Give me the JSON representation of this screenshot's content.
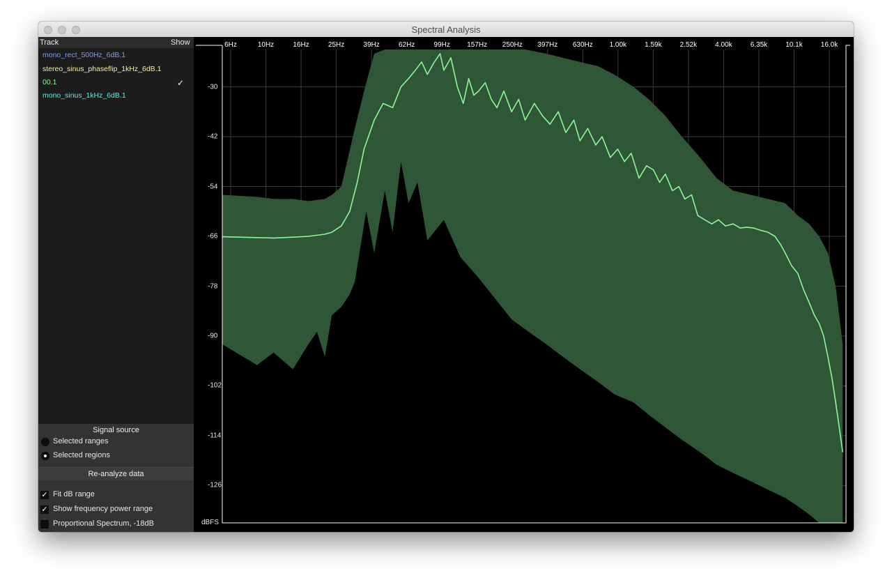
{
  "window": {
    "title": "Spectral Analysis"
  },
  "tracks": {
    "header_track": "Track",
    "header_show": "Show",
    "items": [
      {
        "name": "mono_rect_500Hz_6dB.1",
        "color": "#7f9bff",
        "shown": false
      },
      {
        "name": "stereo_sinus_phaseflip_1kHz_6dB.1",
        "color": "#f5efa0",
        "shown": false
      },
      {
        "name": "00.1",
        "color": "#8ef59a",
        "shown": true,
        "check": "✓"
      },
      {
        "name": "mono_sinus_1kHz_6dB.1",
        "color": "#5fe8e8",
        "shown": false
      }
    ]
  },
  "signal_source": {
    "title": "Signal source",
    "options": [
      {
        "label": "Selected ranges",
        "selected": false
      },
      {
        "label": "Selected regions",
        "selected": true
      }
    ]
  },
  "reanalyze_label": "Re-analyze data",
  "options": [
    {
      "label": "Fit dB range",
      "checked": true
    },
    {
      "label": "Show frequency power range",
      "checked": true
    },
    {
      "label": "Proportional Spectrum, -18dB",
      "checked": false
    }
  ],
  "check_glyph": "✓",
  "chart_data": {
    "type": "area",
    "x_scale": "log",
    "x_ticks": [
      "6Hz",
      "10Hz",
      "16Hz",
      "25Hz",
      "39Hz",
      "62Hz",
      "99Hz",
      "157Hz",
      "250Hz",
      "397Hz",
      "630Hz",
      "1.00k",
      "1.59k",
      "2.52k",
      "4.00k",
      "6.35k",
      "10.1k",
      "16.0k"
    ],
    "y_ticks": [
      "-30",
      "-42",
      "-54",
      "-66",
      "-78",
      "-90",
      "-102",
      "-114",
      "-126"
    ],
    "ylabel": "dBFS",
    "ylim": [
      -135,
      -21
    ],
    "xlim_hz": [
      5,
      23000
    ],
    "grid": true,
    "colors": {
      "band": "#2f5636",
      "line": "#8ff59b",
      "grid": "#3c3c3c",
      "accent": "#8ef59a"
    },
    "series": [
      {
        "name": "00.1",
        "role": "mean spectrum",
        "x": [
          5,
          8,
          10,
          13,
          16,
          20,
          22,
          25,
          28,
          31,
          34,
          39,
          44,
          50,
          56,
          62,
          68,
          74,
          80,
          88,
          95,
          100,
          110,
          120,
          130,
          140,
          150,
          160,
          175,
          190,
          205,
          225,
          250,
          275,
          300,
          340,
          380,
          420,
          470,
          520,
          580,
          630,
          700,
          780,
          850,
          950,
          1050,
          1150,
          1260,
          1400,
          1550,
          1700,
          1850,
          2000,
          2200,
          2400,
          2600,
          2850,
          3100,
          3400,
          3750,
          4100,
          4500,
          5000,
          5500,
          6000,
          6600,
          7200,
          8000,
          8800,
          9500,
          10100,
          11000,
          12000,
          13000,
          14000,
          15000,
          16000,
          17000,
          18000,
          19000,
          20000,
          21000,
          22000
        ],
        "y": [
          -66.1,
          -66.3,
          -66.4,
          -66.2,
          -66,
          -65.5,
          -65,
          -63.5,
          -60,
          -53,
          -45,
          -38,
          -34,
          -35,
          -30,
          -28,
          -26,
          -24,
          -27,
          -24,
          -22,
          -26,
          -23,
          -30,
          -34,
          -28,
          -32,
          -31,
          -29,
          -33,
          -35,
          -31,
          -36,
          -33,
          -38,
          -34,
          -37,
          -39,
          -36,
          -41,
          -38,
          -43,
          -40,
          -44,
          -42,
          -47,
          -45,
          -48,
          -46,
          -52,
          -49,
          -50,
          -53,
          -51,
          -55,
          -54,
          -57,
          -56,
          -61,
          -62,
          -63,
          -62,
          -63.5,
          -63,
          -64,
          -63.8,
          -64,
          -64.5,
          -65,
          -66,
          -68,
          -70,
          -73,
          -75,
          -79,
          -82,
          -85,
          -87,
          -90,
          -95,
          -100,
          -106,
          -112,
          -118
        ]
      },
      {
        "name": "power range max",
        "x": [
          5,
          8,
          10,
          13,
          16,
          20,
          22,
          25,
          30,
          35,
          39,
          45,
          50,
          56,
          62,
          70,
          80,
          100,
          125,
          150,
          200,
          250,
          300,
          400,
          500,
          630,
          800,
          1000,
          1300,
          1600,
          2000,
          2500,
          3200,
          4000,
          5000,
          6350,
          8000,
          10100,
          12000,
          14000,
          16000,
          18000,
          20000,
          22000
        ],
        "y": [
          -56,
          -56.5,
          -57,
          -57,
          -57.5,
          -57,
          -56,
          -54,
          -40,
          -29,
          -22,
          -21,
          -21,
          -21,
          -21,
          -21,
          -21,
          -21,
          -21,
          -21,
          -21,
          -21,
          -21,
          -22,
          -23,
          -24,
          -25,
          -27,
          -30,
          -33,
          -37,
          -42,
          -47,
          -52,
          -55,
          -56,
          -57,
          -58,
          -61,
          -63,
          -66,
          -70,
          -78,
          -92
        ]
      },
      {
        "name": "power range min",
        "x": [
          5,
          8,
          10,
          13,
          16,
          18,
          20,
          22,
          25,
          28,
          30,
          35,
          39,
          45,
          50,
          56,
          62,
          70,
          80,
          100,
          125,
          160,
          200,
          250,
          315,
          400,
          500,
          630,
          800,
          1000,
          1300,
          1600,
          2000,
          2500,
          3200,
          4000,
          5000,
          6350,
          8000,
          10100,
          12000,
          14000,
          16000,
          17000,
          18000,
          19000,
          20000,
          22000
        ],
        "y": [
          -92,
          -97,
          -94,
          -98,
          -92,
          -89,
          -95,
          -85,
          -83,
          -80,
          -77,
          -60,
          -70,
          -55,
          -65,
          -48,
          -58,
          -53,
          -67,
          -62,
          -71,
          -76,
          -81,
          -86,
          -89,
          -92,
          -95,
          -98,
          -101,
          -104,
          -106,
          -109,
          -112,
          -115,
          -118,
          -121,
          -123,
          -125,
          -127,
          -129,
          -131,
          -133,
          -136,
          -138,
          -140,
          -140,
          -140,
          -140
        ]
      }
    ]
  }
}
